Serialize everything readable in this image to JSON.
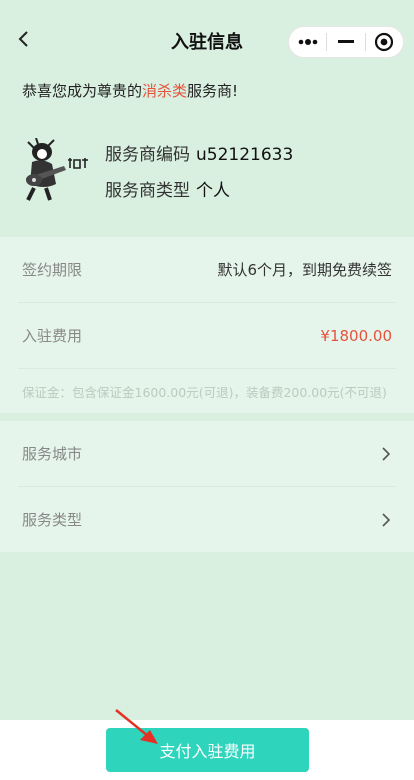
{
  "header": {
    "title": "入驻信息",
    "back_icon": "chevron-left-icon",
    "capsule": {
      "more_icon": "more-dots-icon",
      "minimize_icon": "minimize-icon",
      "close_icon": "target-close-icon"
    }
  },
  "welcome": {
    "prefix": "恭喜您成为尊贵的",
    "highlight": "消杀类",
    "suffix": "服务商!",
    "highlight_color": "#e5533d"
  },
  "provider": {
    "code_label": "服务商编码",
    "code_value": "u52121633",
    "type_label": "服务商类型",
    "type_value": "个人",
    "avatar_icon": "guitar-player-avatar-icon"
  },
  "contract": {
    "term_label": "签约期限",
    "term_value": "默认6个月，到期免费续签",
    "fee_label": "入驻费用",
    "fee_value": "¥1800.00",
    "deposit_note": "保证金：包含保证金1600.00元(可退)，装备费200.00元(不可退)"
  },
  "service": {
    "city_label": "服务城市",
    "type_label": "服务类型",
    "chevron_icon": "chevron-right-icon"
  },
  "footer": {
    "pay_button": "支付入驻费用",
    "button_color": "#2fd4bd",
    "annotation_icon": "red-arrow-icon"
  }
}
